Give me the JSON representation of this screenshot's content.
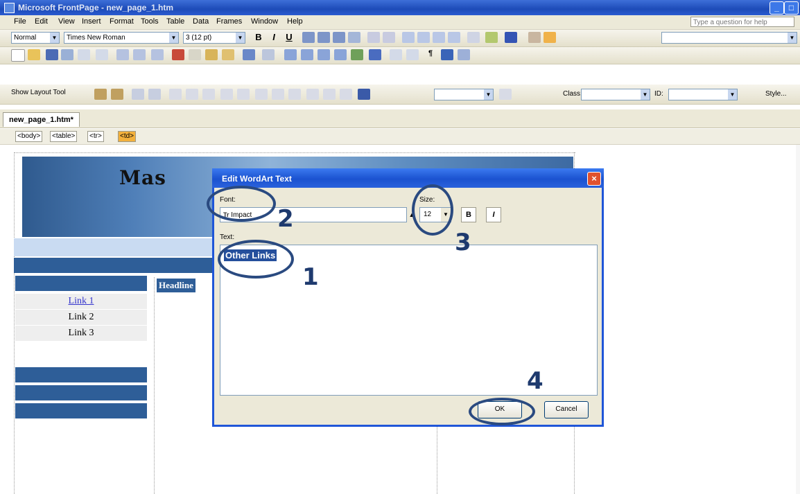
{
  "window": {
    "title": "Microsoft FrontPage - new_page_1.htm",
    "controls": [
      "_",
      "□",
      "×"
    ]
  },
  "menu": {
    "items": [
      "File",
      "Edit",
      "View",
      "Insert",
      "Format",
      "Tools",
      "Table",
      "Data",
      "Frames",
      "Window",
      "Help"
    ],
    "help_placeholder": "Type a question for help"
  },
  "formatting_toolbar": {
    "style": "Normal",
    "font": "Times New Roman",
    "size": "3 (12 pt)",
    "bold": "B",
    "italic": "I",
    "underline": "U"
  },
  "tables_toolbar": {
    "show_layout_tool": "Show Layout Tool",
    "class_label": "Class:",
    "id_label": "ID:",
    "style_label": "Style..."
  },
  "document": {
    "tab": "new_page_1.htm*",
    "tags": [
      "<body>",
      "<table>",
      "<tr>",
      "<td>"
    ],
    "banner_text": "Mas",
    "links": [
      "Link 1",
      "Link 2",
      "Link 3"
    ],
    "headline": "Headline"
  },
  "dialog": {
    "title": "Edit WordArt Text",
    "font_label": "Font:",
    "font_value": "Impact",
    "size_label": "Size:",
    "size_value": "12",
    "bold_label": "B",
    "italic_label": "I",
    "text_label": "Text:",
    "text_value": "Other Links",
    "ok_label": "OK",
    "cancel_label": "Cancel",
    "close_label": "×"
  },
  "annotations": [
    "1",
    "2",
    "3",
    "4"
  ]
}
